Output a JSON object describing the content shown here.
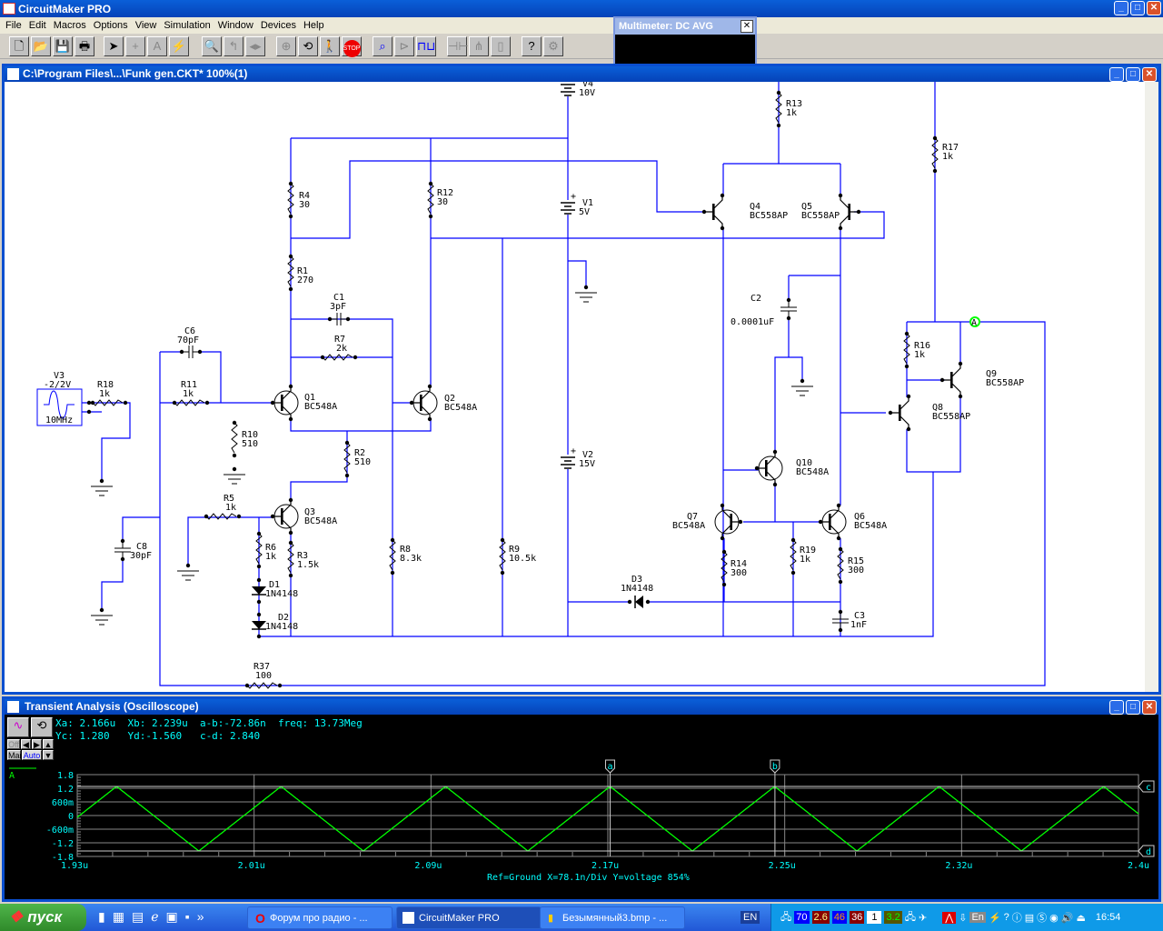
{
  "app": {
    "title": "CircuitMaker PRO"
  },
  "menu": [
    "File",
    "Edit",
    "Macros",
    "Options",
    "View",
    "Simulation",
    "Window",
    "Devices",
    "Help"
  ],
  "toolbar": [
    "new-icon",
    "open-icon",
    "save-icon",
    "print-icon",
    "arrow-icon",
    "wire-icon",
    "text-icon",
    "probe-icon",
    "zoom-icon",
    "rotate-icon",
    "mirror-icon",
    "digital-sim-icon",
    "reset-icon",
    "step-icon",
    "stop-icon",
    "probe-active-icon",
    "analog-icon",
    "digital-icon",
    "parts-icon",
    "search-parts-icon",
    "macro-icon",
    "help-icon",
    "settings-icon"
  ],
  "stop_label": "STOP",
  "multimeter": {
    "title": "Multimeter: DC AVG",
    "close": "✕"
  },
  "document": {
    "title": "C:\\Program Files\\...\\Funk gen.CKT* 100%(1)"
  },
  "schematic": {
    "source": {
      "name": "V3",
      "value": "-2/2V",
      "freq": "10MHz"
    },
    "resistors": [
      {
        "name": "R18",
        "value": "1k"
      },
      {
        "name": "R11",
        "value": "1k"
      },
      {
        "name": "R10",
        "value": "510"
      },
      {
        "name": "R4",
        "value": "30"
      },
      {
        "name": "R1",
        "value": "270"
      },
      {
        "name": "R7",
        "value": "2k"
      },
      {
        "name": "R12",
        "value": "30"
      },
      {
        "name": "R2",
        "value": "510"
      },
      {
        "name": "R5",
        "value": "1k"
      },
      {
        "name": "R6",
        "value": "1k"
      },
      {
        "name": "R3",
        "value": "1.5k"
      },
      {
        "name": "R8",
        "value": "8.3k"
      },
      {
        "name": "R9",
        "value": "10.5k"
      },
      {
        "name": "R37",
        "value": "100"
      },
      {
        "name": "R13",
        "value": "1k"
      },
      {
        "name": "R17",
        "value": "1k"
      },
      {
        "name": "R16",
        "value": "1k"
      },
      {
        "name": "R14",
        "value": "300"
      },
      {
        "name": "R19",
        "value": "1k"
      },
      {
        "name": "R15",
        "value": "300"
      }
    ],
    "capacitors": [
      {
        "name": "C6",
        "value": "70pF"
      },
      {
        "name": "C1",
        "value": "3pF"
      },
      {
        "name": "C8",
        "value": "30pF"
      },
      {
        "name": "C2",
        "value": "0.0001uF"
      },
      {
        "name": "C3",
        "value": "1nF"
      }
    ],
    "transistors": [
      {
        "name": "Q1",
        "value": "BC548A"
      },
      {
        "name": "Q2",
        "value": "BC548A"
      },
      {
        "name": "Q3",
        "value": "BC548A"
      },
      {
        "name": "Q4",
        "value": "BC558AP"
      },
      {
        "name": "Q5",
        "value": "BC558AP"
      },
      {
        "name": "Q10",
        "value": "BC548A"
      },
      {
        "name": "Q7",
        "value": "BC548A"
      },
      {
        "name": "Q6",
        "value": "BC548A"
      },
      {
        "name": "Q8",
        "value": "BC558AP"
      },
      {
        "name": "Q9",
        "value": "BC558AP"
      }
    ],
    "batteries": [
      {
        "name": "V4",
        "value": "10V"
      },
      {
        "name": "V1",
        "value": "5V"
      },
      {
        "name": "V2",
        "value": "15V"
      }
    ],
    "diodes": [
      {
        "name": "D1",
        "value": "1N4148"
      },
      {
        "name": "D2",
        "value": "1N4148"
      },
      {
        "name": "D3",
        "value": "1N4148"
      }
    ],
    "probe": "A",
    "wire_color": "#0000ff"
  },
  "scope": {
    "title": "Transient Analysis (Oscilloscope)",
    "readout": {
      "line1": "Xa: 2.166u  Xb: 2.239u  a-b:-72.86n  freq: 13.73Meg",
      "line2": "Yc: 1.280   Yd:-1.560   c-d: 2.840"
    },
    "buttons": {
      "off": "Off",
      "man": "Man",
      "auto": "Auto"
    },
    "footer": "Ref=Ground  X=78.1n/Div Y=voltage 854%",
    "cursor_labels": {
      "a": "a",
      "b": "b",
      "c": "c",
      "d": "d"
    }
  },
  "chart_data": {
    "type": "line",
    "series": [
      {
        "name": "A",
        "color": "#00ff00",
        "shape": "triangle",
        "max": 1.28,
        "min": -1.56,
        "period_s": 7.286e-08,
        "peak_time_u": 2.166
      }
    ],
    "xlim": [
      1.93,
      2.4
    ],
    "ylim": [
      -1.8,
      1.8
    ],
    "x_ticks": [
      "1.93u",
      "2.01u",
      "2.09u",
      "2.17u",
      "2.25u",
      "2.32u",
      "2.4u"
    ],
    "y_ticks": [
      "1.8",
      "1.2",
      "600m",
      "0",
      "-600m",
      "-1.2",
      "-1.8"
    ],
    "cursors": {
      "a": 2.166,
      "b": 2.239,
      "c": 1.28,
      "d": -1.56
    },
    "grid": true,
    "background": "#000000",
    "axis_color": "#00ffff"
  },
  "taskbar": {
    "start": "пуск",
    "tasks": [
      "Форум про радио - ...",
      "CircuitMaker PRO",
      "Безымянный3.bmp - ..."
    ],
    "lang": "EN",
    "tray_numbers": [
      "70",
      "2.6",
      "46",
      "36",
      "1",
      "3.2"
    ],
    "tray_lang": "En",
    "clock": "16:54"
  }
}
